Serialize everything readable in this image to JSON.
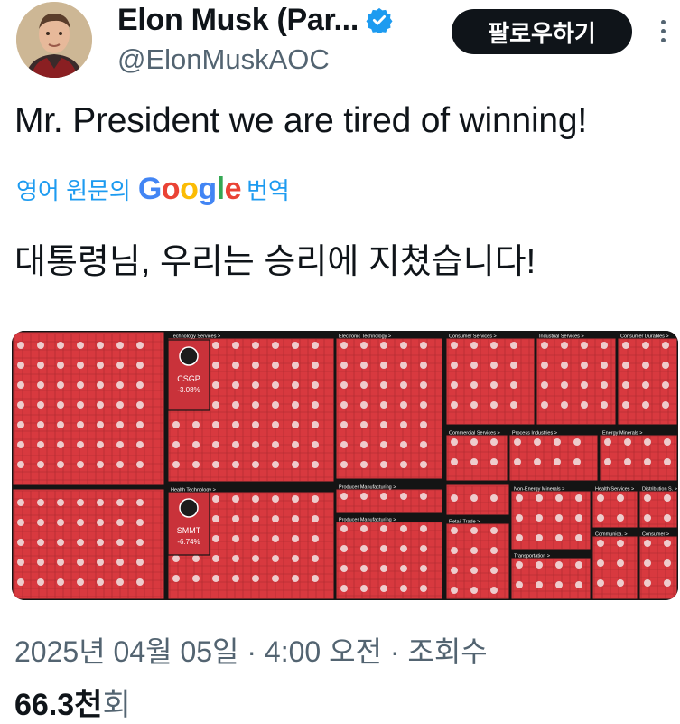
{
  "header": {
    "display_name": "Elon Musk (Par...",
    "handle": "@ElonMuskAOC",
    "follow_label": "팔로우하기"
  },
  "tweet": {
    "text": "Mr. President we are tired of winning!",
    "translate_prefix": "영어 원문의",
    "translate_brand": "Google",
    "translate_suffix": "번역",
    "translated_text": "대통령님, 우리는 승리에 지쳤습니다!"
  },
  "media": {
    "sectors": [
      "Technology Services",
      "Electronic Technology",
      "Consumer Services",
      "Industrial Services",
      "Consumer Durables",
      "Health Technology",
      "Producer Manufacturing",
      "Commercial Services",
      "Process Industries",
      "Energy Minerals",
      "Retail Trade",
      "Non-Energy Minerals",
      "Health Services",
      "Distribution S.",
      "Transportation",
      "Communica.",
      "Consumer"
    ],
    "callouts": [
      {
        "ticker": "CSGP",
        "change": "-3.08%"
      },
      {
        "ticker": "SMMT",
        "change": "-6.74%"
      }
    ],
    "tile_color": "#d8393f",
    "border_color": "#141414"
  },
  "footer": {
    "timestamp": "2025년 04월 05일 · 4:00 오전 · 조회수",
    "views_count": "66.3천",
    "views_unit": "회"
  }
}
